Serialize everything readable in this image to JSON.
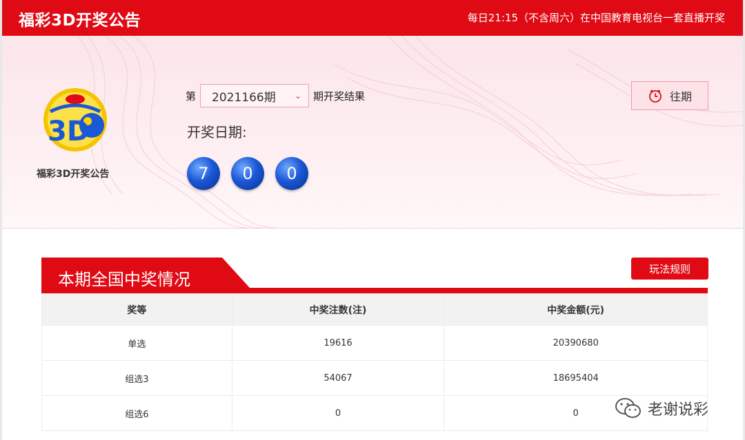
{
  "header": {
    "title": "福彩3D开奖公告",
    "notice": "每日21:15（不含周六）在中国教育电视台一套直播开奖"
  },
  "hero": {
    "logo_caption": "福彩3D开奖公告",
    "issue_prefix": "第",
    "issue_value": "2021166期",
    "issue_suffix": "期开奖结果",
    "date_label": "开奖日期:",
    "balls": [
      "7",
      "0",
      "0"
    ],
    "history_label": "往期"
  },
  "section": {
    "title": "本期全国中奖情况",
    "rules_label": "玩法规则"
  },
  "table": {
    "headers": [
      "奖等",
      "中奖注数(注)",
      "中奖金额(元)"
    ],
    "rows": [
      [
        "单选",
        "19616",
        "20390680"
      ],
      [
        "组选3",
        "54067",
        "18695404"
      ],
      [
        "组选6",
        "0",
        "0"
      ]
    ]
  },
  "watermark": {
    "text": "老谢说彩"
  },
  "colors": {
    "brand_red": "#e00a14",
    "ball_blue": "#1b58d6"
  }
}
